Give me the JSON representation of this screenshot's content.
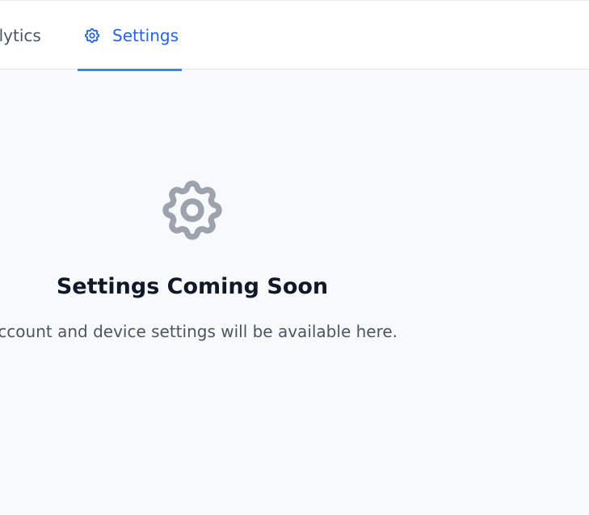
{
  "tabs": {
    "analytics_label": "Analytics",
    "settings_label": "Settings",
    "active": "Settings"
  },
  "empty_state": {
    "icon": "gear-icon",
    "title": "Settings Coming Soon",
    "description": "Account and device settings will be available here."
  },
  "colors": {
    "accent": "#2563eb",
    "underline": "#3b82f6",
    "icon_muted": "#9ca3af",
    "background": "#f8f9fb"
  }
}
